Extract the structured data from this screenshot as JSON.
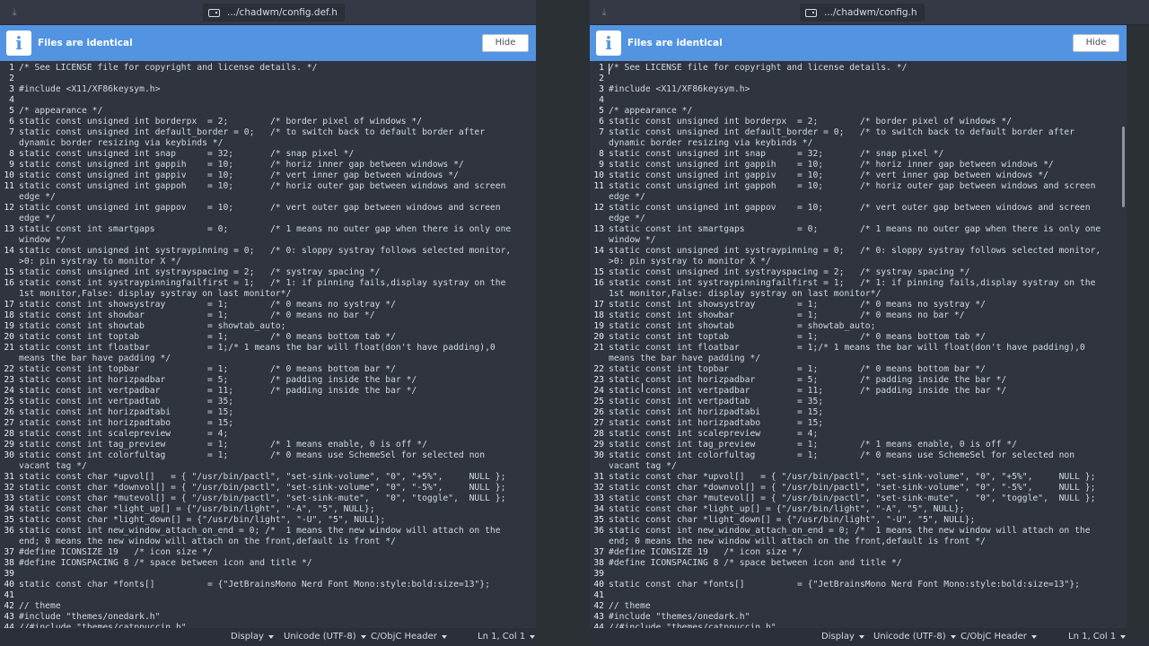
{
  "infobar": {
    "message": "Files are identical",
    "hide_label": "Hide",
    "icon": "info-icon"
  },
  "panes": {
    "left": {
      "file_path": ".../chadwm/config.def.h"
    },
    "right": {
      "file_path": ".../chadwm/config.h"
    }
  },
  "status": {
    "display": "Display",
    "encoding": "Unicode (UTF-8)",
    "language": "C/ObjC Header",
    "position": "Ln 1, Col 1"
  },
  "colors": {
    "accent": "#5294e2",
    "editor_bg": "#2f343f",
    "text": "#d3dae3"
  },
  "lines": [
    {
      "n": "1",
      "t": "/* See LICENSE file for copyright and license details. */"
    },
    {
      "n": "2",
      "t": ""
    },
    {
      "n": "3",
      "t": "#include <X11/XF86keysym.h>"
    },
    {
      "n": "4",
      "t": ""
    },
    {
      "n": "5",
      "t": "/* appearance */"
    },
    {
      "n": "6",
      "t": "static const unsigned int borderpx  = 2;        /* border pixel of windows */"
    },
    {
      "n": "7",
      "t": "static const unsigned int default_border = 0;   /* to switch back to default border after"
    },
    {
      "n": "",
      "t": "dynamic border resizing via keybinds */"
    },
    {
      "n": "8",
      "t": "static const unsigned int snap      = 32;       /* snap pixel */"
    },
    {
      "n": "9",
      "t": "static const unsigned int gappih    = 10;       /* horiz inner gap between windows */"
    },
    {
      "n": "10",
      "t": "static const unsigned int gappiv    = 10;       /* vert inner gap between windows */"
    },
    {
      "n": "11",
      "t": "static const unsigned int gappoh    = 10;       /* horiz outer gap between windows and screen"
    },
    {
      "n": "",
      "t": "edge */"
    },
    {
      "n": "12",
      "t": "static const unsigned int gappov    = 10;       /* vert outer gap between windows and screen"
    },
    {
      "n": "",
      "t": "edge */"
    },
    {
      "n": "13",
      "t": "static const int smartgaps          = 0;        /* 1 means no outer gap when there is only one"
    },
    {
      "n": "",
      "t": "window */"
    },
    {
      "n": "14",
      "t": "static const unsigned int systraypinning = 0;   /* 0: sloppy systray follows selected monitor,"
    },
    {
      "n": "",
      "t": ">0: pin systray to monitor X */"
    },
    {
      "n": "15",
      "t": "static const unsigned int systrayspacing = 2;   /* systray spacing */"
    },
    {
      "n": "16",
      "t": "static const int systraypinningfailfirst = 1;   /* 1: if pinning fails,display systray on the"
    },
    {
      "n": "",
      "t": "1st monitor,False: display systray on last monitor*/"
    },
    {
      "n": "17",
      "t": "static const int showsystray        = 1;        /* 0 means no systray */"
    },
    {
      "n": "18",
      "t": "static const int showbar            = 1;        /* 0 means no bar */"
    },
    {
      "n": "19",
      "t": "static const int showtab            = showtab_auto;"
    },
    {
      "n": "20",
      "t": "static const int toptab             = 1;        /* 0 means bottom tab */"
    },
    {
      "n": "21",
      "t": "static const int floatbar           = 1;/* 1 means the bar will float(don't have padding),0"
    },
    {
      "n": "",
      "t": "means the bar have padding */"
    },
    {
      "n": "22",
      "t": "static const int topbar             = 1;        /* 0 means bottom bar */"
    },
    {
      "n": "23",
      "t": "static const int horizpadbar        = 5;        /* padding inside the bar */"
    },
    {
      "n": "24",
      "t": "static const int vertpadbar         = 11;       /* padding inside the bar */"
    },
    {
      "n": "25",
      "t": "static const int vertpadtab         = 35;"
    },
    {
      "n": "26",
      "t": "static const int horizpadtabi       = 15;"
    },
    {
      "n": "27",
      "t": "static const int horizpadtabo       = 15;"
    },
    {
      "n": "28",
      "t": "static const int scalepreview       = 4;"
    },
    {
      "n": "29",
      "t": "static const int tag_preview        = 1;        /* 1 means enable, 0 is off */"
    },
    {
      "n": "30",
      "t": "static const int colorfultag        = 1;        /* 0 means use SchemeSel for selected non"
    },
    {
      "n": "",
      "t": "vacant tag */"
    },
    {
      "n": "31",
      "t": "static const char *upvol[]   = { \"/usr/bin/pactl\", \"set-sink-volume\", \"0\", \"+5%\",     NULL };"
    },
    {
      "n": "32",
      "t": "static const char *downvol[] = { \"/usr/bin/pactl\", \"set-sink-volume\", \"0\", \"-5%\",     NULL };"
    },
    {
      "n": "33",
      "t": "static const char *mutevol[] = { \"/usr/bin/pactl\", \"set-sink-mute\",   \"0\", \"toggle\",  NULL };"
    },
    {
      "n": "34",
      "t": "static const char *light_up[] = {\"/usr/bin/light\", \"-A\", \"5\", NULL};"
    },
    {
      "n": "35",
      "t": "static const char *light_down[] = {\"/usr/bin/light\", \"-U\", \"5\", NULL};"
    },
    {
      "n": "36",
      "t": "static const int new_window_attach_on_end = 0; /*  1 means the new window will attach on the"
    },
    {
      "n": "",
      "t": "end; 0 means the new window will attach on the front,default is front */"
    },
    {
      "n": "37",
      "t": "#define ICONSIZE 19   /* icon size */"
    },
    {
      "n": "38",
      "t": "#define ICONSPACING 8 /* space between icon and title */"
    },
    {
      "n": "39",
      "t": ""
    },
    {
      "n": "40",
      "t": "static const char *fonts[]          = {\"JetBrainsMono Nerd Font Mono:style:bold:size=13\"};"
    },
    {
      "n": "41",
      "t": ""
    },
    {
      "n": "42",
      "t": "// theme"
    },
    {
      "n": "43",
      "t": "#include \"themes/onedark.h\""
    },
    {
      "n": "44",
      "t": "//#include \"themes/catppuccin.h\""
    }
  ]
}
